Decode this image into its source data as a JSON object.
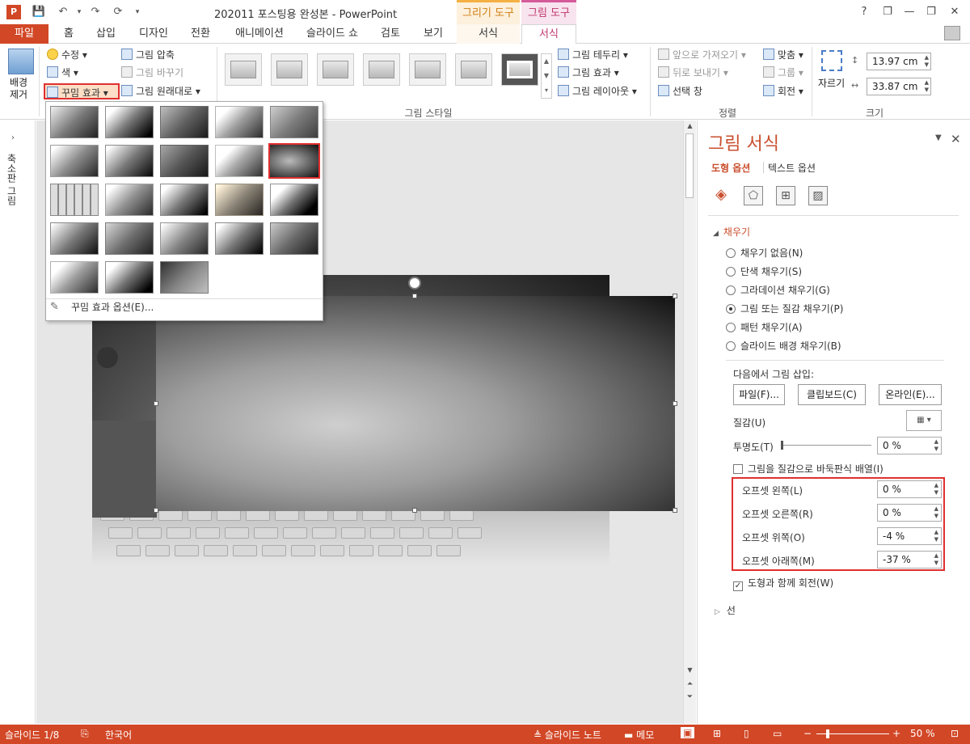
{
  "window": {
    "title": "202011 포스팅용 완성본 - PowerPoint",
    "app_icon": "P",
    "help": "?",
    "controls": {
      "minimize": "—",
      "restore": "❐",
      "close": "✕"
    }
  },
  "quick_access": {
    "save_icon": "💾",
    "undo_icon": "↶",
    "redo_icon": "↷",
    "custom_icon": "⟳",
    "more": "▾"
  },
  "contextual": {
    "drawing_tools": "그리기 도구",
    "picture_tools": "그림 도구"
  },
  "tabs": [
    "파일",
    "홈",
    "삽입",
    "디자인",
    "전환",
    "애니메이션",
    "슬라이드 쇼",
    "검토",
    "보기",
    "서식",
    "서식"
  ],
  "ribbon": {
    "remove_bg": {
      "line1": "배경",
      "line2": "제거"
    },
    "adjust": {
      "corrections": "수정",
      "color": "색",
      "artistic_effects": "꾸밈 효과",
      "compress": "그림 압축",
      "change": "그림 바꾸기",
      "reset": "그림 원래대로"
    },
    "styles_label": "그림 스타일",
    "style_cmds": {
      "border": "그림 테두리",
      "effects": "그림 효과",
      "layout": "그림 레이아웃"
    },
    "arrange": {
      "bring_forward": "앞으로 가져오기",
      "send_backward": "뒤로 보내기",
      "selection_pane": "선택 창",
      "align": "맞춤",
      "group": "그룹",
      "rotate": "회전",
      "label": "정렬"
    },
    "size": {
      "crop": "자르기",
      "height": "13.97 cm",
      "width": "33.87 cm",
      "label": "크기"
    }
  },
  "thumbnails_label": "축소판 그림",
  "fx_dropdown": {
    "options_label": "꾸밈 효과 옵션(E)..."
  },
  "pane": {
    "title": "그림 서식",
    "tabs": {
      "shape_options": "도형 옵션",
      "text_options": "텍스트 옵션"
    },
    "fill_section": "채우기",
    "fill_options": [
      "채우기 없음(N)",
      "단색 채우기(S)",
      "그라데이션 채우기(G)",
      "그림 또는 질감 채우기(P)",
      "패턴 채우기(A)",
      "슬라이드 배경 채우기(B)"
    ],
    "selected_fill": 3,
    "insert_from": "다음에서 그림 삽입:",
    "buttons": {
      "file": "파일(F)...",
      "clipboard": "클립보드(C)",
      "online": "온라인(E)..."
    },
    "texture_label": "질감(U)",
    "transparency_label": "투명도(T)",
    "transparency_value": "0 %",
    "tile_label": "그림을 질감으로 바둑판식 배열(I)",
    "offsets": [
      {
        "label": "오프셋 왼쪽(L)",
        "value": "0 %"
      },
      {
        "label": "오프셋 오른쪽(R)",
        "value": "0 %"
      },
      {
        "label": "오프셋 위쪽(O)",
        "value": "-4 %"
      },
      {
        "label": "오프셋 아래쪽(M)",
        "value": "-37 %"
      }
    ],
    "rotate_with_shape": "도형과 함께 회전(W)",
    "line_section": "선"
  },
  "status": {
    "slide": "슬라이드 1/8",
    "language": "한국어",
    "notes": "슬라이드 노트",
    "comments": "메모",
    "zoom": "50 %"
  }
}
